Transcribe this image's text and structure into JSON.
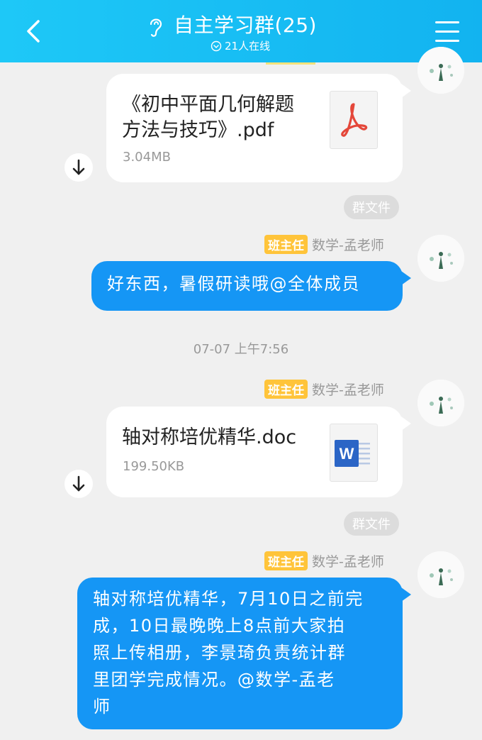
{
  "header": {
    "title": "自主学习群(25)",
    "online": "21人在线"
  },
  "messages": {
    "file1": {
      "name_line1": "《初中平面几何解题",
      "name_line2": "方法与技巧》.pdf",
      "size": "3.04MB",
      "icon": "pdf-icon"
    },
    "tag1": "群文件",
    "msg1": {
      "badge": "班主任",
      "sender": "数学-孟老师",
      "text": "好东西，暑假研读哦@全体成员"
    },
    "timestamp": "07-07 上午7:56",
    "msg2": {
      "badge": "班主任",
      "sender": "数学-孟老师"
    },
    "file2": {
      "name": "轴对称培优精华.doc",
      "size": "199.50KB",
      "icon": "word-icon"
    },
    "tag2": "群文件",
    "msg3": {
      "badge": "班主任",
      "sender": "数学-孟老师",
      "lines": [
        "轴对称培优精华，7月10日之前完",
        "成，10日最晚晚上8点前大家拍",
        "照上传相册，李景琦负责统计群",
        "里团学完成情况。@数学-孟老",
        "师"
      ]
    }
  },
  "colors": {
    "header": "#12b3f0",
    "bubble": "#1596f5",
    "badge": "#ffc43a"
  }
}
